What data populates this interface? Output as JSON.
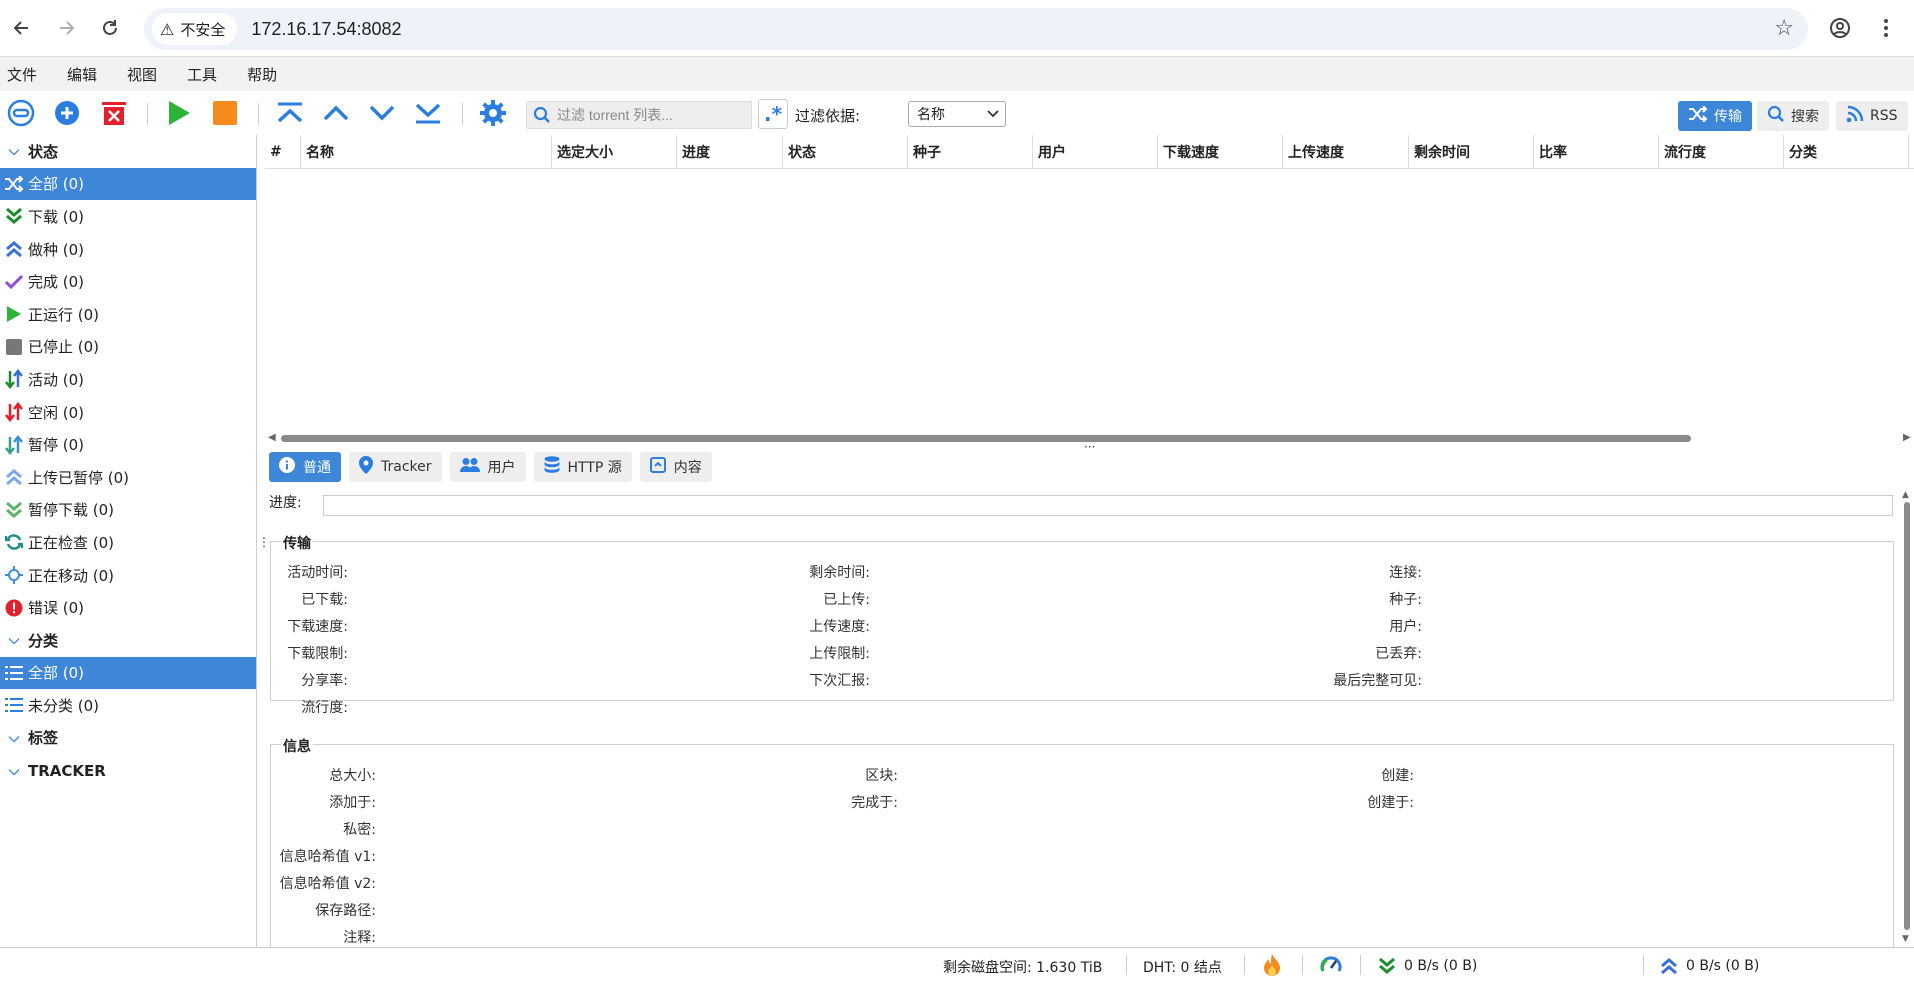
{
  "browser": {
    "security_label": "不安全",
    "url": "172.16.17.54:8082"
  },
  "menu": [
    "文件",
    "编辑",
    "视图",
    "工具",
    "帮助"
  ],
  "toolbar": {
    "filter_placeholder": "过滤 torrent 列表...",
    "filter_by_label": "过滤依据:",
    "filter_by_value": "名称",
    "tabs": {
      "transfer": "传输",
      "search": "搜索",
      "rss": "RSS"
    }
  },
  "sidebar": {
    "status_header": "状态",
    "status_items": [
      {
        "label": "全部 (0)",
        "icon": "shuffle-icon"
      },
      {
        "label": "下载 (0)",
        "icon": "download-icon"
      },
      {
        "label": "做种 (0)",
        "icon": "upload-icon"
      },
      {
        "label": "完成 (0)",
        "icon": "checkmark-icon"
      },
      {
        "label": "正运行 (0)",
        "icon": "play-icon"
      },
      {
        "label": "已停止 (0)",
        "icon": "stop-icon"
      },
      {
        "label": "活动 (0)",
        "icon": "active-arrows-icon"
      },
      {
        "label": "空闲 (0)",
        "icon": "inactive-arrows-icon"
      },
      {
        "label": "暂停 (0)",
        "icon": "paused-arrows-icon"
      },
      {
        "label": "上传已暂停 (0)",
        "icon": "upload-paused-icon"
      },
      {
        "label": "暂停下载 (0)",
        "icon": "download-paused-icon"
      },
      {
        "label": "正在检查 (0)",
        "icon": "refresh-icon"
      },
      {
        "label": "正在移动 (0)",
        "icon": "moving-icon"
      },
      {
        "label": "错误 (0)",
        "icon": "error-icon"
      }
    ],
    "category_header": "分类",
    "category_items": [
      {
        "label": "全部 (0)",
        "icon": "list-icon"
      },
      {
        "label": "未分类 (0)",
        "icon": "list-icon"
      }
    ],
    "tags_header": "标签",
    "tracker_header": "TRACKER"
  },
  "table": {
    "columns": [
      "#",
      "名称",
      "选定大小",
      "进度",
      "状态",
      "种子",
      "用户",
      "下载速度",
      "上传速度",
      "剩余时间",
      "比率",
      "流行度",
      "分类"
    ]
  },
  "props": {
    "tabs": [
      "普通",
      "Tracker",
      "用户",
      "HTTP 源",
      "内容"
    ],
    "progress_label": "进度:",
    "transfer_legend": "传输",
    "transfer_col1": [
      "活动时间:",
      "已下载:",
      "下载速度:",
      "下载限制:",
      "分享率:",
      "流行度:"
    ],
    "transfer_col2": [
      "剩余时间:",
      "已上传:",
      "上传速度:",
      "上传限制:",
      "下次汇报:"
    ],
    "transfer_col3": [
      "连接:",
      "种子:",
      "用户:",
      "已丢弃:",
      "最后完整可见:"
    ],
    "info_legend": "信息",
    "info_col1": [
      "总大小:",
      "添加于:",
      "私密:",
      "信息哈希值 v1:",
      "信息哈希值 v2:",
      "保存路径:",
      "注释:"
    ],
    "info_col2": [
      "区块:",
      "完成于:"
    ],
    "info_col3": [
      "创建:",
      "创建于:"
    ]
  },
  "status": {
    "disk_space": "剩余磁盘空间: 1.630 TiB",
    "dht": "DHT: 0 结点",
    "download_speed": "0 B/s (0 B)",
    "upload_speed": "0 B/s (0 B)"
  },
  "colors": {
    "accent": "#3d86d8",
    "resume_green": "#2db33a",
    "stop_orange": "#f78a1d",
    "delete_red": "#e3202b"
  }
}
